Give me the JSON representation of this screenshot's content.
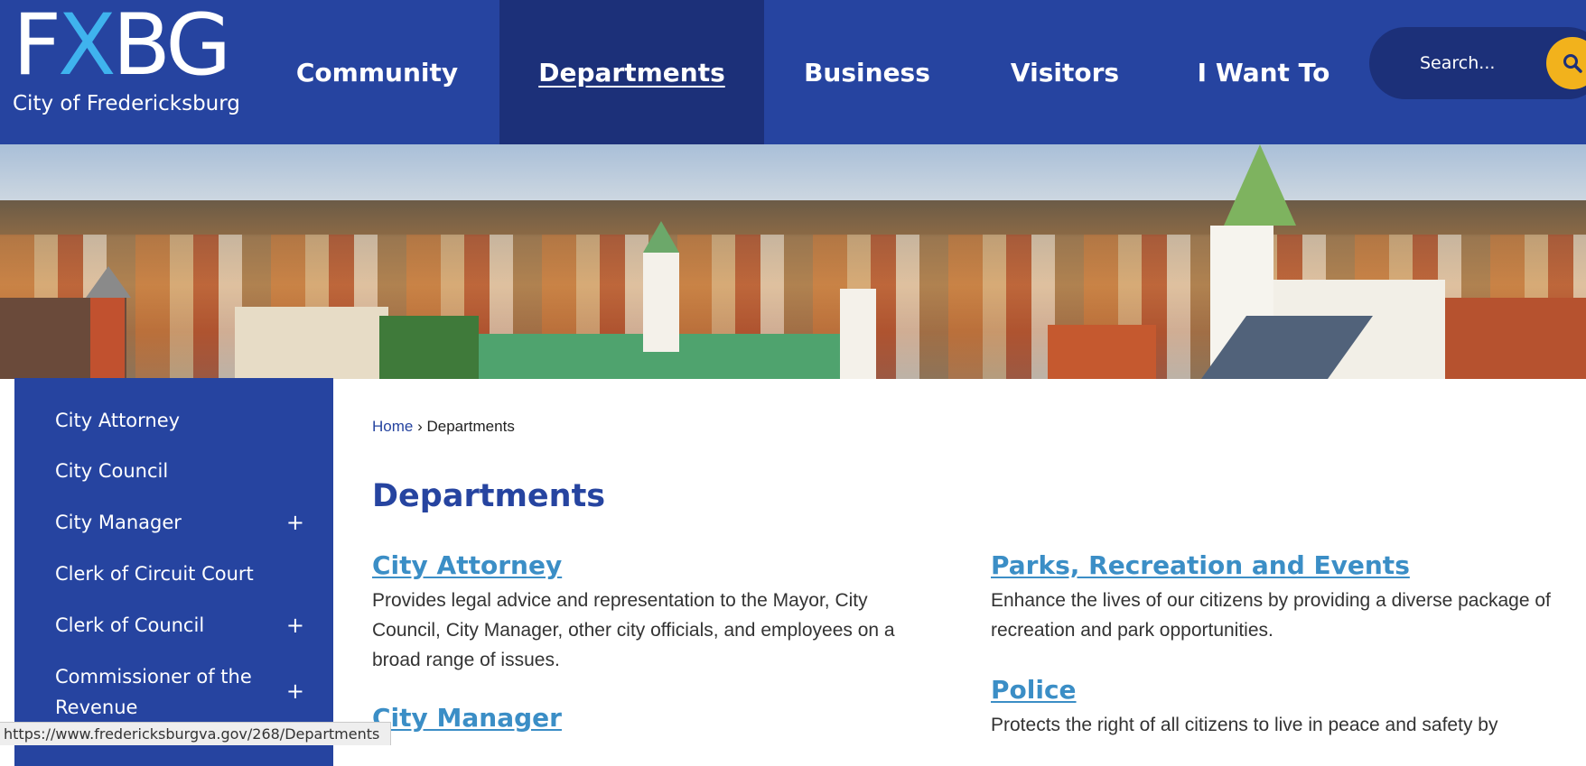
{
  "header": {
    "logo_text": "FXBG",
    "logo_subtitle": "City of Fredericksburg",
    "nav": [
      {
        "label": "Community"
      },
      {
        "label": "Departments",
        "active": true
      },
      {
        "label": "Business"
      },
      {
        "label": "Visitors"
      },
      {
        "label": "I Want To"
      }
    ],
    "search": {
      "placeholder": "Search..."
    }
  },
  "sidebar": {
    "items": [
      {
        "label": "City Attorney",
        "expandable": false
      },
      {
        "label": "City Council",
        "expandable": false
      },
      {
        "label": "City Manager",
        "expandable": true,
        "toggle": "+"
      },
      {
        "label": "Clerk of Circuit Court",
        "expandable": false
      },
      {
        "label": "Clerk of Council",
        "expandable": true,
        "toggle": "+"
      },
      {
        "label": "Commissioner of the Revenue",
        "expandable": true,
        "toggle": "+"
      }
    ]
  },
  "breadcrumb": {
    "home": "Home",
    "separator": "›",
    "current": "Departments"
  },
  "main": {
    "title": "Departments",
    "departments_left": [
      {
        "title": "City Attorney",
        "description": "Provides legal advice and representation to the Mayor, City Council, City Manager, other city officials, and employees on a broad range of issues."
      },
      {
        "title": "City Manager",
        "description": ""
      }
    ],
    "departments_right": [
      {
        "title": "Parks, Recreation and Events",
        "description": "Enhance the lives of our citizens by providing a diverse package of recreation and park opportunities."
      },
      {
        "title": "Police",
        "description": "Protects the right of all citizens to live in peace and safety by"
      }
    ]
  },
  "statusbar": {
    "url": "https://www.fredericksburgva.gov/268/Departments"
  },
  "colors": {
    "brand_blue": "#2644a0",
    "active_nav_blue": "#1c3079",
    "link_blue": "#3b8ec6",
    "logo_x_blue": "#3fb3ee",
    "search_accent": "#f2b21c"
  },
  "icons": {
    "search": "search-icon",
    "expand": "plus-icon"
  }
}
